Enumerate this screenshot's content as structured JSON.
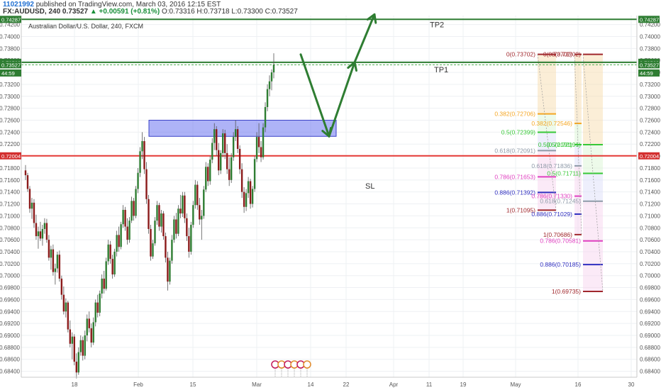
{
  "header": {
    "user_id": "11021992",
    "published_text": "published on TradingView.com, March 03, 2016 12:15 EST",
    "symbol_text": "FX:AUDUSD, 240",
    "last_price": "0.73527",
    "change_text": "▲ +0.00591 (+0.81%)",
    "ohlc_text": "O:0.73316 H:0.73718 L:0.73300 C:0.73527"
  },
  "chart_title": "Australian Dollar/U.S. Dollar, 240, FXCM",
  "chart_data": {
    "type": "candlestick",
    "title": "Australian Dollar/U.S. Dollar, 240, FXCM",
    "y_axis_ticks": [
      "0.74200",
      "0.74000",
      "0.73800",
      "0.73600",
      "0.73400",
      "0.73200",
      "0.73000",
      "0.72800",
      "0.72600",
      "0.72400",
      "0.72200",
      "0.72000",
      "0.71800",
      "0.71600",
      "0.71400",
      "0.71200",
      "0.71000",
      "0.70800",
      "0.70600",
      "0.70400",
      "0.70200",
      "0.70000",
      "0.69800",
      "0.69600",
      "0.69400",
      "0.69200",
      "0.69000",
      "0.68800",
      "0.68600",
      "0.68400"
    ],
    "ylim": [
      0.683,
      0.7435
    ],
    "x_axis_ticks": [
      "18",
      "Feb",
      "15",
      "Mar",
      "14",
      "22",
      "Apr",
      "11",
      "19",
      "May",
      "16",
      "30"
    ],
    "price_labels": [
      {
        "text": "0.74287",
        "value": 0.74287,
        "color": "#2e7d32"
      },
      {
        "text": "0.73569",
        "value": 0.73569,
        "color": "#2e7d32"
      },
      {
        "text": "0.73527",
        "value": 0.73527,
        "color": "#2e7d32"
      },
      {
        "text": "44:59",
        "value": 0.7339,
        "color": "#2e7d32"
      },
      {
        "text": "0.72004",
        "value": 0.72004,
        "color": "#d32f2f"
      }
    ],
    "horizontal_lines": [
      {
        "name": "tp2-line",
        "value": 0.74287,
        "color": "#2e7d32"
      },
      {
        "name": "tp1-line",
        "value": 0.73569,
        "color": "#2e7d32"
      },
      {
        "name": "current-price-line",
        "value": 0.73527,
        "color": "#4caf50",
        "dashed": true
      },
      {
        "name": "sl-line",
        "value": 0.72004,
        "color": "#e53935"
      }
    ],
    "annotations": [
      {
        "text": "TP2",
        "value": 0.742
      },
      {
        "text": "TP1",
        "value": 0.7345
      },
      {
        "text": "SL",
        "value": 0.715
      }
    ],
    "zone": {
      "top": 0.726,
      "bottom": 0.7233,
      "color": "#6b74f0"
    },
    "path_points": [
      [
        0.737,
        0.737
      ],
      [
        0.7233,
        0.7233
      ],
      [
        0.73569,
        0.73569
      ],
      [
        0.7437,
        0.7437
      ]
    ],
    "fib_sets": [
      {
        "levels": [
          {
            "text": "0(0.73702)",
            "value": 0.73702,
            "color": "#a0282d"
          },
          {
            "text": "0.382(0.72706)",
            "value": 0.72706,
            "color": "#f5a623"
          },
          {
            "text": "0.5(0.72399)",
            "value": 0.72399,
            "color": "#37c837"
          },
          {
            "text": "0.618(0.72091)",
            "value": 0.72091,
            "color": "#8e9aa8"
          },
          {
            "text": "0.786(0.71653)",
            "value": 0.71653,
            "color": "#e040c0"
          },
          {
            "text": "0.886(0.71392)",
            "value": 0.71392,
            "color": "#3030c0"
          },
          {
            "text": "1(0.71095)",
            "value": 0.71095,
            "color": "#a0282d"
          }
        ]
      },
      {
        "levels": [
          {
            "text": "0(0.73702)",
            "value": 0.73702,
            "color": "#a0282d"
          },
          {
            "text": "0.382(0.72546)",
            "value": 0.72546,
            "color": "#f5a623"
          },
          {
            "text": "0.5(0.72191)",
            "value": 0.72191,
            "color": "#37c837"
          },
          {
            "text": "0.618(0.71836)",
            "value": 0.71836,
            "color": "#8e9aa8"
          },
          {
            "text": "0.786(0.71330)",
            "value": 0.7133,
            "color": "#e040c0"
          },
          {
            "text": "0.886(0.71029)",
            "value": 0.71029,
            "color": "#3030c0"
          },
          {
            "text": "1(0.70686)",
            "value": 0.70686,
            "color": "#a0282d"
          }
        ]
      },
      {
        "levels": [
          {
            "text": "0(0.73702)",
            "value": 0.73702,
            "color": "#a0282d"
          },
          {
            "text": "0.5(0.72191)",
            "value": 0.72191,
            "color": "#37c837"
          },
          {
            "text": "0.5(0.71711)",
            "value": 0.71711,
            "color": "#37c837"
          },
          {
            "text": "0.618(0.71245)",
            "value": 0.71245,
            "color": "#8e9aa8"
          },
          {
            "text": "0.786(0.70581)",
            "value": 0.70581,
            "color": "#e040c0"
          },
          {
            "text": "0.886(0.70185)",
            "value": 0.70185,
            "color": "#3030c0"
          },
          {
            "text": "1(0.69735)",
            "value": 0.69735,
            "color": "#a0282d"
          }
        ]
      }
    ],
    "candles": [
      [
        0.7176,
        0.7185,
        0.716,
        0.7168
      ],
      [
        0.7168,
        0.7172,
        0.714,
        0.7145
      ],
      [
        0.7145,
        0.715,
        0.7105,
        0.7112
      ],
      [
        0.7112,
        0.713,
        0.7095,
        0.7122
      ],
      [
        0.7122,
        0.7128,
        0.708,
        0.7088
      ],
      [
        0.7088,
        0.7102,
        0.706,
        0.7066
      ],
      [
        0.7066,
        0.7082,
        0.7045,
        0.7074
      ],
      [
        0.7074,
        0.709,
        0.7058,
        0.7062
      ],
      [
        0.7062,
        0.7085,
        0.705,
        0.7078
      ],
      [
        0.7078,
        0.7096,
        0.707,
        0.7088
      ],
      [
        0.7088,
        0.7095,
        0.7055,
        0.706
      ],
      [
        0.706,
        0.7068,
        0.7025,
        0.703
      ],
      [
        0.703,
        0.705,
        0.701,
        0.7044
      ],
      [
        0.7044,
        0.7052,
        0.7,
        0.7006
      ],
      [
        0.7006,
        0.702,
        0.6985,
        0.7012
      ],
      [
        0.7012,
        0.704,
        0.7005,
        0.7035
      ],
      [
        0.7035,
        0.7042,
        0.699,
        0.6995
      ],
      [
        0.6995,
        0.7,
        0.696,
        0.6968
      ],
      [
        0.6968,
        0.6982,
        0.6935,
        0.694
      ],
      [
        0.694,
        0.6962,
        0.693,
        0.6955
      ],
      [
        0.6955,
        0.6958,
        0.6905,
        0.691
      ],
      [
        0.691,
        0.6925,
        0.688,
        0.6886
      ],
      [
        0.6886,
        0.6905,
        0.686,
        0.6898
      ],
      [
        0.6898,
        0.6902,
        0.685,
        0.6856
      ],
      [
        0.6856,
        0.687,
        0.6828,
        0.6838
      ],
      [
        0.6838,
        0.688,
        0.6834,
        0.6872
      ],
      [
        0.6872,
        0.69,
        0.6866,
        0.6892
      ],
      [
        0.6892,
        0.6898,
        0.6858,
        0.6866
      ],
      [
        0.6866,
        0.6908,
        0.686,
        0.69
      ],
      [
        0.69,
        0.6935,
        0.689,
        0.6928
      ],
      [
        0.6928,
        0.694,
        0.6905,
        0.6912
      ],
      [
        0.6912,
        0.692,
        0.688,
        0.6888
      ],
      [
        0.6888,
        0.693,
        0.6884,
        0.6922
      ],
      [
        0.6922,
        0.696,
        0.6915,
        0.6955
      ],
      [
        0.6955,
        0.6968,
        0.693,
        0.6938
      ],
      [
        0.6938,
        0.6975,
        0.6932,
        0.697
      ],
      [
        0.697,
        0.7002,
        0.6962,
        0.6995
      ],
      [
        0.6995,
        0.7008,
        0.697,
        0.6978
      ],
      [
        0.6978,
        0.703,
        0.6975,
        0.7024
      ],
      [
        0.7024,
        0.706,
        0.7018,
        0.7052
      ],
      [
        0.7052,
        0.7058,
        0.702,
        0.7028
      ],
      [
        0.7028,
        0.7035,
        0.6995,
        0.7002
      ],
      [
        0.7002,
        0.7045,
        0.6998,
        0.704
      ],
      [
        0.704,
        0.7075,
        0.7032,
        0.7068
      ],
      [
        0.7068,
        0.7082,
        0.704,
        0.7048
      ],
      [
        0.7048,
        0.709,
        0.7044,
        0.7086
      ],
      [
        0.7086,
        0.7118,
        0.708,
        0.711
      ],
      [
        0.711,
        0.7115,
        0.7075,
        0.7082
      ],
      [
        0.7082,
        0.7096,
        0.7052,
        0.706
      ],
      [
        0.706,
        0.7098,
        0.7055,
        0.7092
      ],
      [
        0.7092,
        0.7132,
        0.7088,
        0.7125
      ],
      [
        0.7125,
        0.713,
        0.7092,
        0.71
      ],
      [
        0.71,
        0.715,
        0.7096,
        0.7145
      ],
      [
        0.7145,
        0.718,
        0.7138,
        0.7172
      ],
      [
        0.7172,
        0.7215,
        0.7165,
        0.7208
      ],
      [
        0.7208,
        0.724,
        0.7195,
        0.7225
      ],
      [
        0.7225,
        0.7232,
        0.717,
        0.7178
      ],
      [
        0.7178,
        0.719,
        0.712,
        0.7128
      ],
      [
        0.7128,
        0.7135,
        0.707,
        0.7078
      ],
      [
        0.7078,
        0.7085,
        0.7025,
        0.7032
      ],
      [
        0.7032,
        0.706,
        0.7028,
        0.7054
      ],
      [
        0.7054,
        0.7098,
        0.705,
        0.7092
      ],
      [
        0.7092,
        0.7125,
        0.7085,
        0.7118
      ],
      [
        0.7118,
        0.7122,
        0.7075,
        0.7082
      ],
      [
        0.7082,
        0.711,
        0.7072,
        0.7104
      ],
      [
        0.7104,
        0.7108,
        0.706,
        0.7066
      ],
      [
        0.7066,
        0.7072,
        0.7022,
        0.703
      ],
      [
        0.703,
        0.704,
        0.6975,
        0.699
      ],
      [
        0.699,
        0.703,
        0.6985,
        0.7025
      ],
      [
        0.7025,
        0.7068,
        0.702,
        0.706
      ],
      [
        0.706,
        0.71,
        0.7055,
        0.7094
      ],
      [
        0.7094,
        0.7105,
        0.7062,
        0.707
      ],
      [
        0.707,
        0.7118,
        0.7066,
        0.7112
      ],
      [
        0.7112,
        0.7135,
        0.7096,
        0.7104
      ],
      [
        0.7104,
        0.714,
        0.7098,
        0.7134
      ],
      [
        0.7134,
        0.714,
        0.7088,
        0.7096
      ],
      [
        0.7096,
        0.7104,
        0.7058,
        0.7066
      ],
      [
        0.7066,
        0.708,
        0.703,
        0.704
      ],
      [
        0.704,
        0.709,
        0.7035,
        0.7085
      ],
      [
        0.7085,
        0.7125,
        0.708,
        0.7118
      ],
      [
        0.7118,
        0.716,
        0.7112,
        0.7152
      ],
      [
        0.7152,
        0.7158,
        0.711,
        0.7118
      ],
      [
        0.7118,
        0.713,
        0.7085,
        0.7094
      ],
      [
        0.7094,
        0.711,
        0.706,
        0.71
      ],
      [
        0.71,
        0.715,
        0.7095,
        0.7144
      ],
      [
        0.7144,
        0.719,
        0.714,
        0.7182
      ],
      [
        0.7182,
        0.7188,
        0.715,
        0.7158
      ],
      [
        0.7158,
        0.72,
        0.7152,
        0.7194
      ],
      [
        0.7194,
        0.723,
        0.7188,
        0.7222
      ],
      [
        0.7222,
        0.7255,
        0.721,
        0.7245
      ],
      [
        0.7245,
        0.725,
        0.72,
        0.721
      ],
      [
        0.721,
        0.7222,
        0.7168,
        0.7176
      ],
      [
        0.7176,
        0.721,
        0.717,
        0.7205
      ],
      [
        0.7205,
        0.7245,
        0.7198,
        0.7238
      ],
      [
        0.7238,
        0.7244,
        0.7195,
        0.7205
      ],
      [
        0.7205,
        0.722,
        0.717,
        0.7178
      ],
      [
        0.7178,
        0.7198,
        0.715,
        0.716
      ],
      [
        0.716,
        0.7205,
        0.7155,
        0.7198
      ],
      [
        0.7198,
        0.724,
        0.7192,
        0.7232
      ],
      [
        0.7232,
        0.726,
        0.7225,
        0.7245
      ],
      [
        0.7245,
        0.725,
        0.7205,
        0.7212
      ],
      [
        0.7212,
        0.7218,
        0.717,
        0.7178
      ],
      [
        0.7178,
        0.7188,
        0.713,
        0.714
      ],
      [
        0.714,
        0.7148,
        0.7105,
        0.7115
      ],
      [
        0.7115,
        0.7145,
        0.7108,
        0.7138
      ],
      [
        0.7138,
        0.7165,
        0.713,
        0.7158
      ],
      [
        0.7158,
        0.7162,
        0.7112,
        0.712
      ],
      [
        0.712,
        0.715,
        0.7114,
        0.7145
      ],
      [
        0.7145,
        0.72,
        0.714,
        0.7195
      ],
      [
        0.7195,
        0.724,
        0.719,
        0.7232
      ],
      [
        0.7232,
        0.7255,
        0.7205,
        0.7215
      ],
      [
        0.7215,
        0.7225,
        0.719,
        0.7198
      ],
      [
        0.7198,
        0.7255,
        0.7194,
        0.7248
      ],
      [
        0.7248,
        0.729,
        0.724,
        0.7282
      ],
      [
        0.7282,
        0.732,
        0.7275,
        0.7312
      ],
      [
        0.7312,
        0.7335,
        0.73,
        0.7325
      ],
      [
        0.7325,
        0.7345,
        0.731,
        0.734
      ],
      [
        0.734,
        0.7372,
        0.733,
        0.7353
      ]
    ]
  }
}
